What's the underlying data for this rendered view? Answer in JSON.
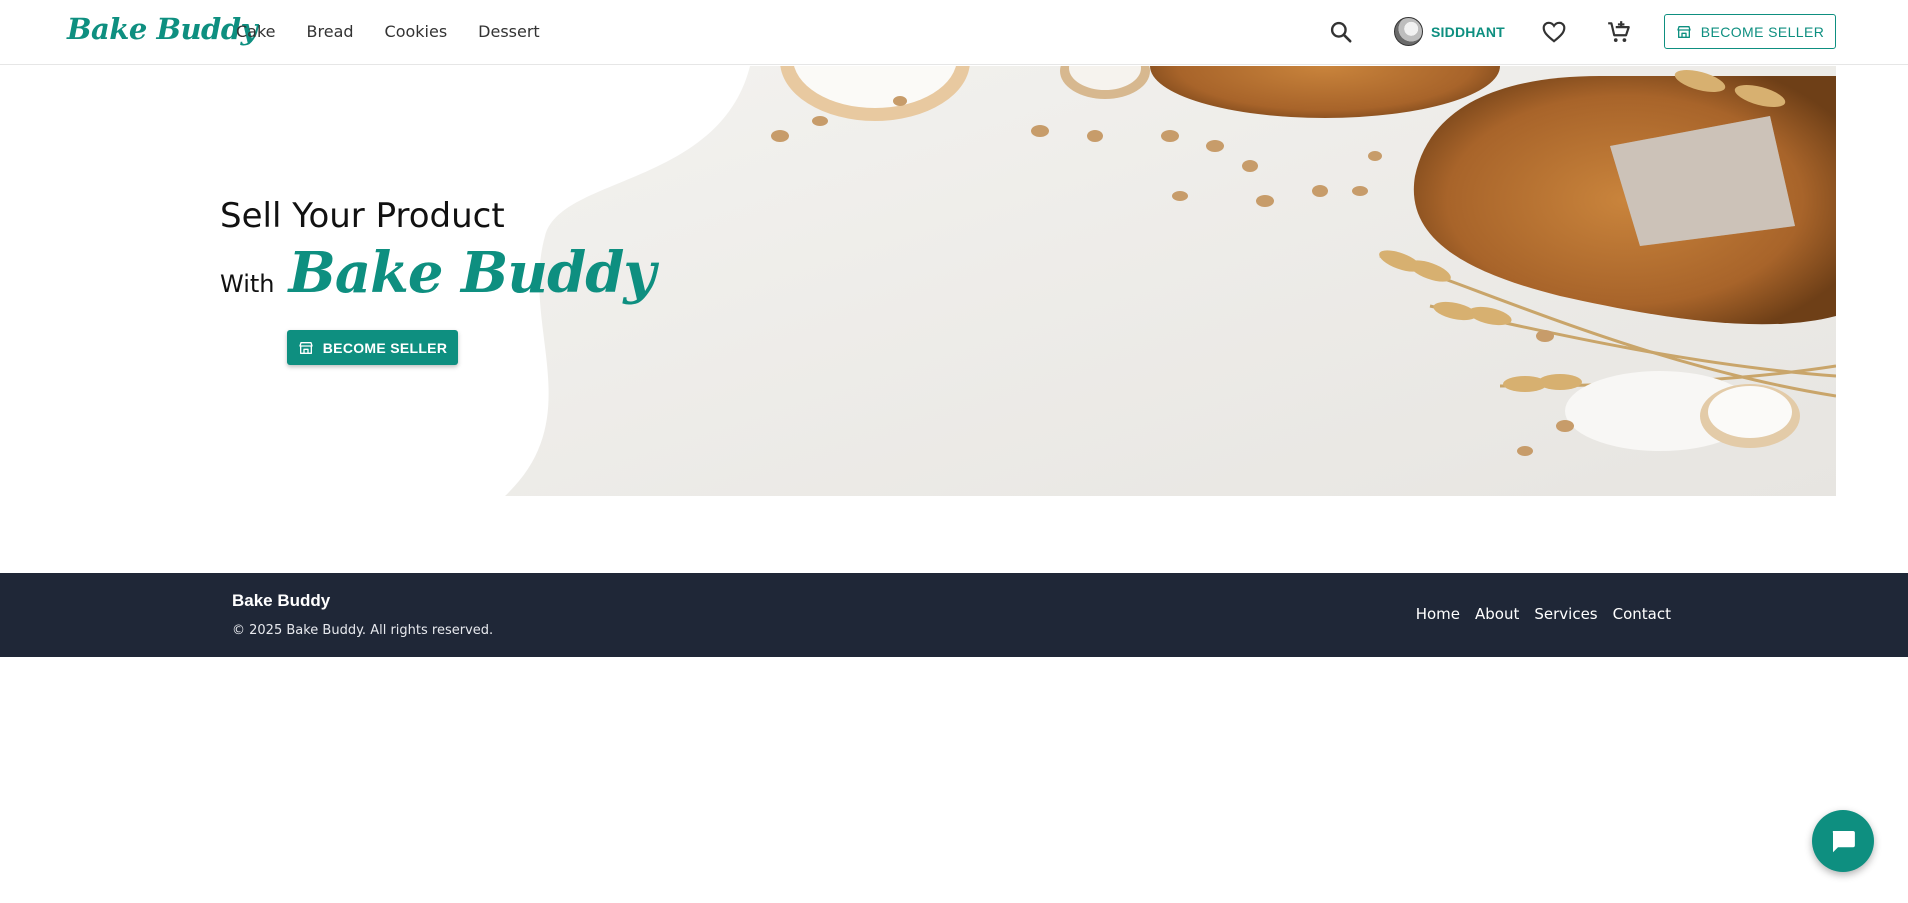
{
  "header": {
    "logo": "Bake Buddy",
    "nav": [
      "Cake",
      "Bread",
      "Cookies",
      "Dessert"
    ],
    "user_name": "SIDDHANT",
    "become_seller_label": "BECOME SELLER"
  },
  "hero": {
    "title": "Sell Your Product",
    "with": "With",
    "brand": "Bake Buddy",
    "button_label": "BECOME SELLER"
  },
  "footer": {
    "brand": "Bake Buddy",
    "copyright": "© 2025 Bake Buddy. All rights reserved.",
    "links": [
      "Home",
      "About",
      "Services",
      "Contact"
    ]
  },
  "colors": {
    "brand": "#0e8f80",
    "footer_bg": "#1f2737"
  },
  "icons": [
    "search-icon",
    "heart-icon",
    "cart-icon",
    "store-icon",
    "chat-icon"
  ]
}
